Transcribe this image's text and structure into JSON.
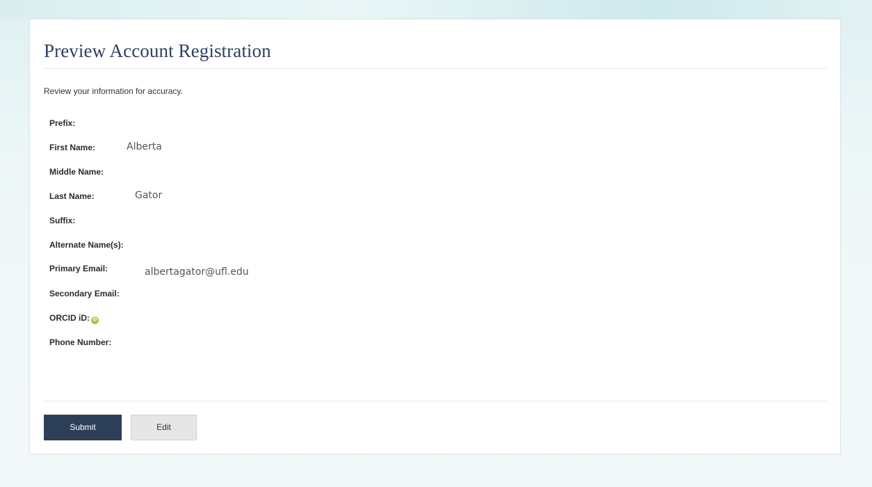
{
  "page": {
    "title": "Preview Account Registration",
    "intro": "Review your information for accuracy."
  },
  "fields": [
    {
      "label": "Prefix:",
      "value": ""
    },
    {
      "label": "First Name:",
      "value": "Alberta"
    },
    {
      "label": "Middle Name:",
      "value": ""
    },
    {
      "label": "Last Name:",
      "value": "Gator"
    },
    {
      "label": "Suffix:",
      "value": ""
    },
    {
      "label": "Alternate Name(s):",
      "value": ""
    },
    {
      "label": "Primary Email:",
      "value": "albertagator@ufl.edu"
    },
    {
      "label": "Secondary Email:",
      "value": ""
    },
    {
      "label": "ORCID iD:",
      "value": "",
      "icon": "orcid-icon"
    },
    {
      "label": "Phone Number:",
      "value": ""
    }
  ],
  "buttons": {
    "submit_label": "Submit",
    "edit_label": "Edit"
  },
  "colors": {
    "primary_button": "#2d3e58",
    "title": "#2d4160",
    "orcid_green": "#a6ce39"
  }
}
